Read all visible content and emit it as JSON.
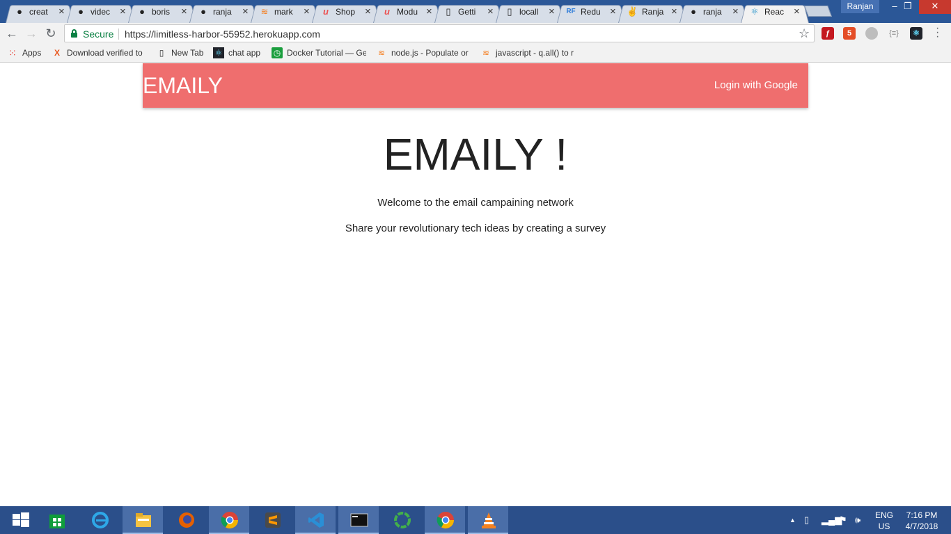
{
  "browser": {
    "profile_name": "Ranjan",
    "tabs": [
      {
        "label": "creat",
        "icon": "github-icon"
      },
      {
        "label": "videc",
        "icon": "github-icon"
      },
      {
        "label": "boris",
        "icon": "github-icon"
      },
      {
        "label": "ranja",
        "icon": "github-icon"
      },
      {
        "label": "mark",
        "icon": "stackoverflow-icon"
      },
      {
        "label": "Shop",
        "icon": "udemy-icon"
      },
      {
        "label": "Modu",
        "icon": "udemy-icon"
      },
      {
        "label": "Getti",
        "icon": "document-icon"
      },
      {
        "label": "locall",
        "icon": "document-icon"
      },
      {
        "label": "Redu",
        "icon": "redux-form-icon"
      },
      {
        "label": "Ranja",
        "icon": "peace-hand-icon"
      },
      {
        "label": "ranja",
        "icon": "github-icon"
      },
      {
        "label": "Reac",
        "icon": "react-icon"
      }
    ],
    "security_label": "Secure",
    "url": "https://limitless-harbor-55952.herokuapp.com",
    "bookmarks": [
      {
        "label": "Apps",
        "icon": "apps-grid-icon"
      },
      {
        "label": "Download verified to",
        "icon": "x-logo-icon"
      },
      {
        "label": "New Tab",
        "icon": "document-icon"
      },
      {
        "label": "chat app",
        "icon": "react-icon"
      },
      {
        "label": "Docker Tutorial — Ge",
        "icon": "clock-icon"
      },
      {
        "label": "node.js - Populate or",
        "icon": "stackoverflow-icon"
      },
      {
        "label": "javascript - q.all() to r",
        "icon": "stackoverflow-icon"
      }
    ]
  },
  "app": {
    "brand": "EMAILY",
    "login_label": "Login with Google",
    "hero_title": "EMAILY !",
    "hero_line1": "Welcome to the email campaining network",
    "hero_line2": "Share your revolutionary tech ideas by creating a survey",
    "nav_color": "#ef6e6e"
  },
  "taskbar": {
    "lang_top": "ENG",
    "lang_bottom": "US",
    "time": "7:16 PM",
    "date": "4/7/2018"
  }
}
